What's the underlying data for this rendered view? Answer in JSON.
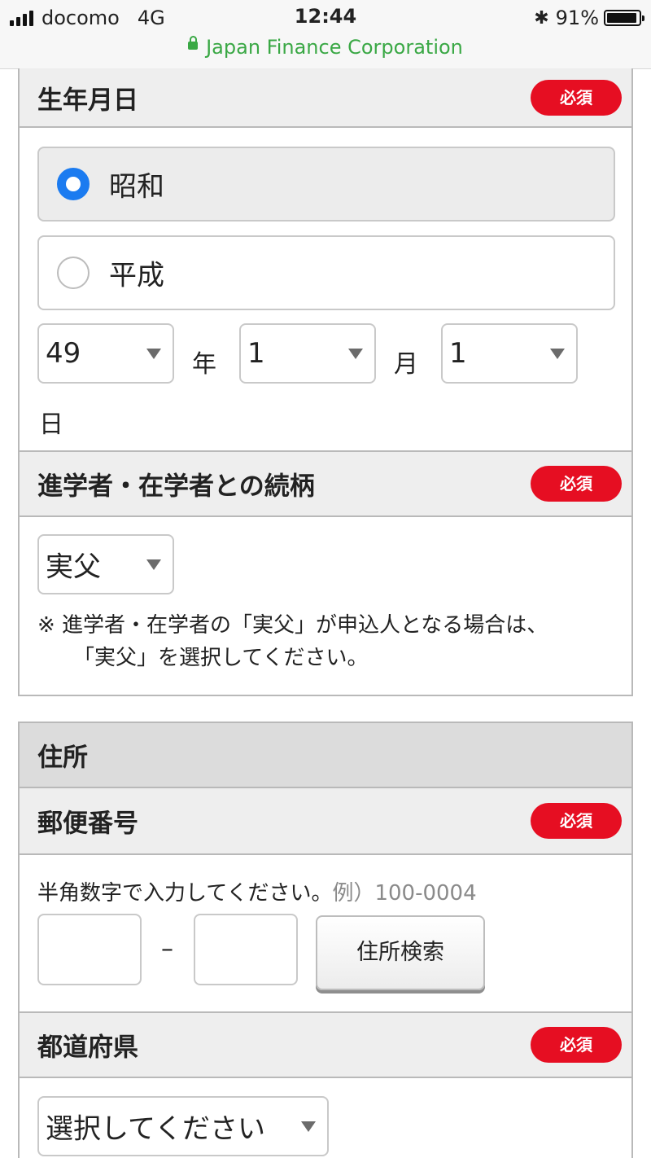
{
  "status_bar": {
    "carrier": "docomo",
    "network": "4G",
    "time": "12:44",
    "battery": "91%",
    "battery_level": 0.91,
    "site": "Japan Finance Corporation",
    "url_color": "#3aa845"
  },
  "required_label": "必須",
  "required_color": "#e60e22",
  "birthdate": {
    "label": "生年月日",
    "eras": [
      {
        "label": "昭和",
        "selected": true
      },
      {
        "label": "平成",
        "selected": false
      }
    ],
    "year_value": "49",
    "year_unit": "年",
    "month_value": "1",
    "month_unit": "月",
    "day_value": "1",
    "day_unit": "日"
  },
  "relationship": {
    "label": "進学者・在学者との続柄",
    "value": "実父",
    "note_line1": "※ 進学者・在学者の「実父」が申込人となる場合は、",
    "note_line2": "「実父」を選択してください。"
  },
  "address": {
    "section_title": "住所",
    "postal_label": "郵便番号",
    "postal_hint": "半角数字で入力してください。",
    "postal_example": "例）100-0004",
    "postal_part1": "",
    "postal_part2": "",
    "postal_separator": "–",
    "search_button": "住所検索",
    "prefecture_label": "都道府県",
    "prefecture_value": "選択してください"
  },
  "accent_color": "#1b7bf0"
}
